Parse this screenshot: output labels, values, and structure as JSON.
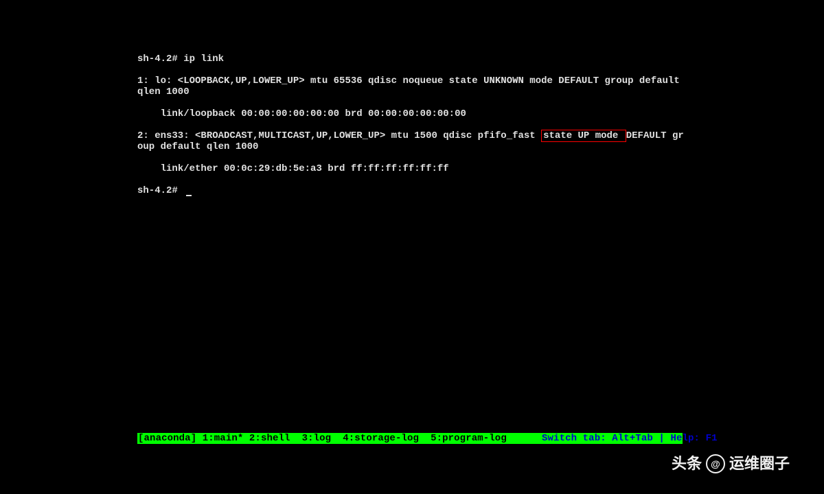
{
  "terminal": {
    "prompt": "sh-4.2#",
    "command": "ip link",
    "indent": "    ",
    "if1": {
      "pre": "1: lo: <LOOPBACK,UP,LOWER_UP> mtu 65536 qdisc noqueue state UNKNOWN mode DEFAULT group default qlen 1000",
      "link": "link/loopback 00:00:00:00:00:00 brd 00:00:00:00:00:00"
    },
    "if2": {
      "pre": "2: ens33: <BROADCAST,MULTICAST,UP,LOWER_UP> mtu 1500 qdisc pfifo_fast ",
      "hl": "state UP mode ",
      "post": "DEFAULT group default qlen 1000",
      "link": "link/ether 00:0c:29:db:5e:a3 brd ff:ff:ff:ff:ff:ff"
    },
    "prompt2": "sh-4.2# "
  },
  "status": {
    "left": "[anaconda] 1:main* 2:shell  3:log  4:storage-log  5:program-log",
    "gap": "      ",
    "right": "Switch tab: Alt+Tab | Help: F1"
  },
  "watermark": {
    "left": "头条",
    "mid": "@",
    "right": "运维圈子"
  }
}
